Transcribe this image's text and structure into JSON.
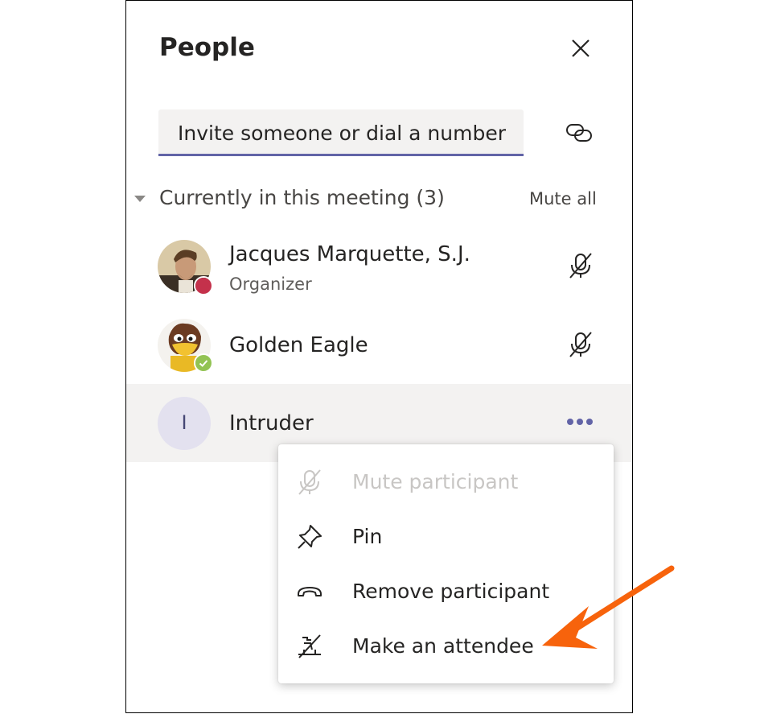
{
  "panel": {
    "title": "People",
    "close_icon": "close-icon",
    "invite_placeholder": "Invite someone or dial a number",
    "share_link_icon": "link-icon"
  },
  "section": {
    "label": "Currently in this meeting",
    "count": "(3)",
    "mute_all": "Mute all"
  },
  "participants": [
    {
      "name": "Jacques Marquette, S.J.",
      "role": "Organizer",
      "status": "busy",
      "status_color": "#c4314b",
      "action_icon": "mic-off-icon"
    },
    {
      "name": "Golden Eagle",
      "role": "",
      "status": "available",
      "status_color": "#92c353",
      "action_icon": "mic-off-icon"
    },
    {
      "name": "Intruder",
      "initial": "I",
      "role": "",
      "action_icon": "more-options-icon"
    }
  ],
  "context_menu": {
    "items": [
      {
        "label": "Mute participant",
        "icon": "mic-off-icon",
        "disabled": true
      },
      {
        "label": "Pin",
        "icon": "pin-icon",
        "disabled": false
      },
      {
        "label": "Remove participant",
        "icon": "hang-up-icon",
        "disabled": false
      },
      {
        "label": "Make an attendee",
        "icon": "make-attendee-icon",
        "disabled": false
      }
    ]
  },
  "colors": {
    "accent": "#6264a7",
    "annotation_arrow": "#f7630c",
    "hover_row": "#f3f2f1",
    "avatar_initial_bg": "#e3e1ef"
  }
}
